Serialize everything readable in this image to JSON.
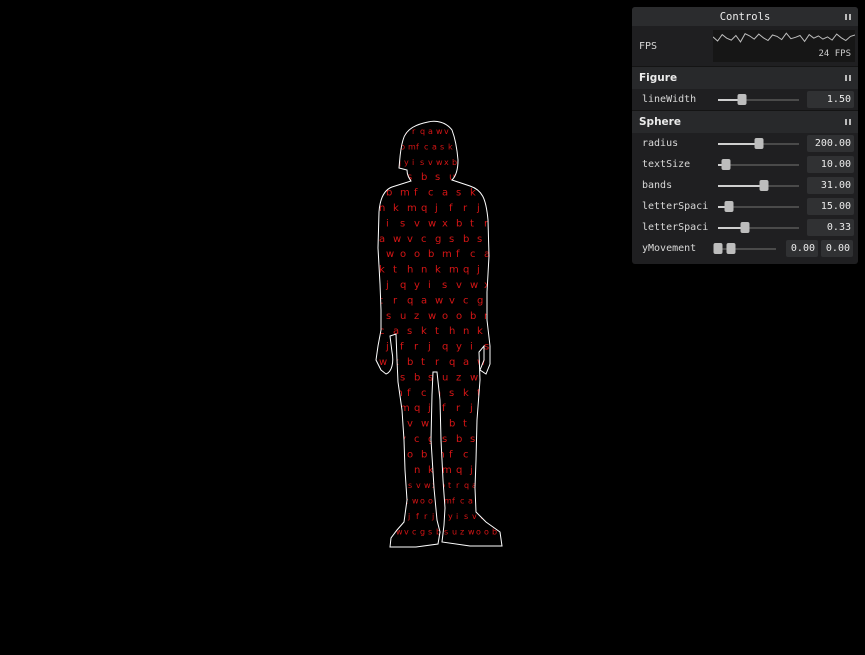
{
  "letters": [
    "v",
    "i",
    "e",
    "w",
    "a",
    "e",
    "x",
    "y",
    "s",
    "b",
    "m",
    "f",
    "t",
    "m",
    "l",
    "r",
    "n",
    "c",
    "q",
    "j",
    "w",
    "a",
    "h",
    "x",
    "w",
    "n",
    "z",
    "v",
    "m",
    "h",
    "c",
    "b",
    "d",
    "g",
    "n",
    "c",
    "s",
    "c",
    "x",
    "b",
    "f",
    "w",
    "s",
    "g",
    "v",
    "u",
    "q",
    "j",
    "z",
    "t",
    "w",
    "w",
    "v",
    "w",
    "o",
    "i",
    "r",
    "o",
    "s",
    "s",
    "b",
    "g",
    "g",
    "m",
    "z",
    "h",
    "f",
    "r",
    "e",
    "c",
    "x",
    "v",
    "a",
    "x",
    "a",
    "s",
    "c",
    "a",
    "k",
    "p",
    "l",
    "t",
    "m",
    "k",
    "h",
    "x",
    "s",
    "n",
    "o",
    "i",
    "k",
    "g",
    "e",
    "m",
    "o",
    "r",
    "q",
    "y",
    "h",
    "j",
    "x",
    "c",
    "f",
    "p",
    "w",
    "r",
    "b",
    "y",
    "j",
    "k",
    "e",
    "q",
    "o",
    "d",
    "y",
    "d",
    "a",
    "i",
    "u",
    "l",
    "s",
    "a",
    "t"
  ],
  "controls": {
    "title": "Controls",
    "fps_label": "FPS",
    "fps_value": "24 FPS",
    "fps_history": [
      55,
      46,
      60,
      52,
      48,
      58,
      44,
      62,
      57,
      50,
      61,
      53,
      47,
      59,
      56,
      49,
      63,
      51,
      54,
      58,
      45,
      60,
      52,
      57,
      50,
      55,
      48,
      61,
      53,
      47,
      56,
      59
    ],
    "figure": {
      "title": "Figure",
      "line_width": {
        "label": "lineWidth",
        "value": "1.50",
        "fraction": 0.3
      }
    },
    "sphere": {
      "title": "Sphere",
      "radius": {
        "label": "radius",
        "value": "200.00",
        "fraction": 0.5
      },
      "text_size": {
        "label": "textSize",
        "value": "10.00",
        "fraction": 0.1
      },
      "bands": {
        "label": "bands",
        "value": "31.00",
        "fraction": 0.57
      },
      "letter_spacing_1": {
        "label": "letterSpaci",
        "value": "15.00",
        "fraction": 0.14
      },
      "letter_spacing_2": {
        "label": "letterSpaci",
        "value": "0.33",
        "fraction": 0.33
      },
      "y_movement": {
        "label": "yMovement",
        "value_a": "0.00",
        "value_b": "0.00",
        "fraction_a": 0.0,
        "fraction_b": 0.27
      }
    }
  },
  "colors": {
    "outline": "#ffffff",
    "letters": "#d61515",
    "background": "#000000"
  }
}
